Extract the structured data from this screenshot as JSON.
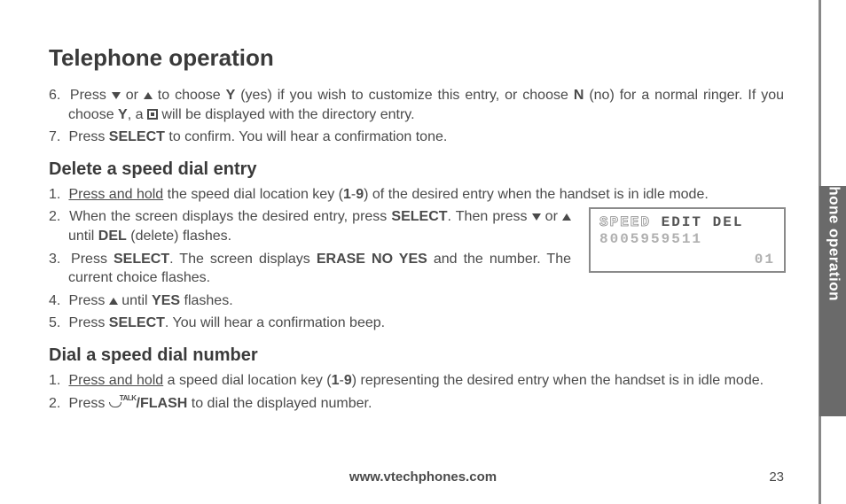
{
  "title": "Telephone operation",
  "list_top": [
    {
      "num": "6.",
      "html": "Press ▼ or ▲ to choose <b>Y</b> (yes) if you wish to customize this entry, or choose <b>N</b> (no) for a normal ringer. If you choose <b>Y</b>, a ◘ will be displayed with the directory entry."
    },
    {
      "num": "7.",
      "html": "Press <b>SELECT</b> to confirm. You will hear a confirmation tone."
    }
  ],
  "section_delete": {
    "heading": "Delete a speed dial entry",
    "items": [
      {
        "num": "1.",
        "html": "<u>Press and hold</u> the speed dial location key (<b>1</b>-<b>9</b>) of the desired entry when the handset is in idle mode."
      },
      {
        "num": "2.",
        "html": "When the screen displays the desired entry, press <b>SELECT</b>. Then press ▼ or ▲ until <b>DEL</b> (delete) flashes."
      },
      {
        "num": "3.",
        "html": "Press <b>SELECT</b>. The screen displays <b>ERASE NO YES</b> and the number. The current choice flashes."
      },
      {
        "num": "4.",
        "html": "Press ▲ until <b>YES</b> flashes."
      },
      {
        "num": "5.",
        "html": "Press <b>SELECT</b>. You will hear a confirmation beep."
      }
    ]
  },
  "section_dial": {
    "heading": "Dial a speed dial number",
    "items": [
      {
        "num": "1.",
        "html": "<u>Press and hold</u> a speed dial location key (<b>1</b>-<b>9</b>) representing the desired entry when the handset is in idle mode."
      },
      {
        "num": "2.",
        "html": "Press <b>☊<sup>TALK</sup>/FLASH</b> to dial the displayed number."
      }
    ]
  },
  "lcd": {
    "line1_outline1": "SPEED",
    "line1_solid1": "EDIT",
    "line1_solid2": "DEL",
    "line2": "8005959511",
    "line3": "01"
  },
  "footer_url": "www.vtechphones.com",
  "page_number": "23",
  "side_tab": "Telephone operation"
}
